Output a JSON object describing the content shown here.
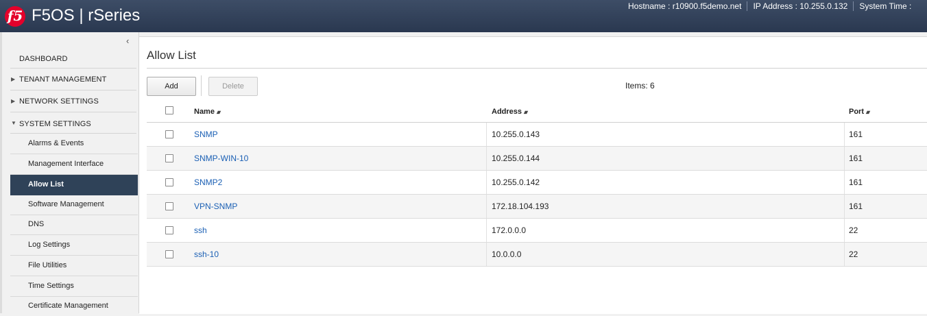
{
  "header": {
    "logo_text": "f5",
    "product": "F5OS | rSeries",
    "hostname": "Hostname : r10900.f5demo.net",
    "ip_address": "IP Address : 10.255.0.132",
    "system_time": "System Time :"
  },
  "sidebar": {
    "collapse_icon": "chevron-left",
    "top_items": [
      {
        "label": "DASHBOARD",
        "caret": ""
      },
      {
        "label": "TENANT MANAGEMENT",
        "caret": "▶"
      },
      {
        "label": "NETWORK SETTINGS",
        "caret": "▶"
      },
      {
        "label": "SYSTEM SETTINGS",
        "caret": "▼"
      }
    ],
    "sub_items": [
      {
        "label": "Alarms & Events"
      },
      {
        "label": "Management Interface"
      },
      {
        "label": "Allow List"
      },
      {
        "label": "Software Management"
      },
      {
        "label": "DNS"
      },
      {
        "label": "Log Settings"
      },
      {
        "label": "File Utilities"
      },
      {
        "label": "Time Settings"
      },
      {
        "label": "Certificate Management"
      }
    ],
    "active_item": "Allow List"
  },
  "main": {
    "title": "Allow List",
    "toolbar": {
      "add_label": "Add",
      "delete_label": "Delete"
    },
    "items_count": "Items: 6",
    "columns": {
      "name": "Name",
      "address": "Address",
      "port": "Port"
    },
    "sort_icon": "sort-arrows",
    "rows": [
      {
        "name": "SNMP",
        "address": "10.255.0.143",
        "port": "161"
      },
      {
        "name": "SNMP-WIN-10",
        "address": "10.255.0.144",
        "port": "161"
      },
      {
        "name": "SNMP2",
        "address": "10.255.0.142",
        "port": "161"
      },
      {
        "name": "VPN-SNMP",
        "address": "172.18.104.193",
        "port": "161"
      },
      {
        "name": "ssh",
        "address": "172.0.0.0",
        "port": "22"
      },
      {
        "name": "ssh-10",
        "address": "10.0.0.0",
        "port": "22"
      }
    ]
  },
  "colors": {
    "header_bg": "#2f3d56",
    "logo_red": "#e4002b",
    "active_nav": "#2f4258",
    "link": "#1a5fb4"
  }
}
